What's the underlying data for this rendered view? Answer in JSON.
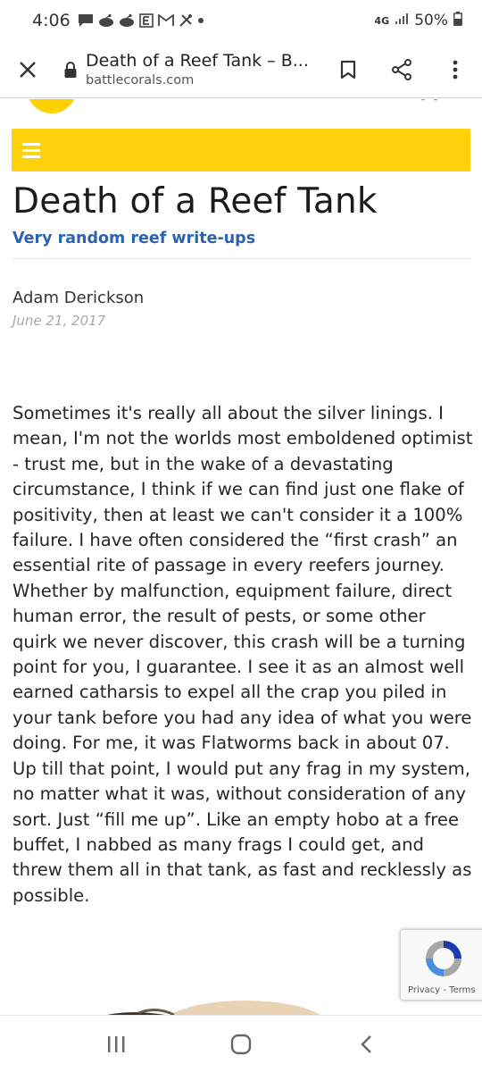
{
  "status_bar": {
    "time": "4:06",
    "network": "4G",
    "battery": "50%",
    "notification_icons": [
      "message-icon",
      "reddit-icon",
      "reddit-icon",
      "news-icon",
      "gmail-icon",
      "tools-icon",
      "dot-icon"
    ]
  },
  "toolbar": {
    "page_title": "Death of a Reef Tank – B...",
    "domain": "battlecorals.com"
  },
  "article": {
    "title": "Death of a Reef Tank",
    "category": "Very random reef write-ups",
    "author": "Adam Derickson",
    "date": "June 21, 2017",
    "body": "Sometimes it's really all about the silver linings.  I mean,  I'm not the worlds most emboldened optimist - trust me, but in the wake of a devastating circumstance, I think if we can find just one flake of positivity, then at least we can't consider it a 100% failure.   I have often considered the “first crash” an essential rite of passage in every reefers journey.  Whether by malfunction, equipment failure, direct human error, the result of pests, or some other quirk we never discover,  this crash will be a turning point for you,  I guarantee.  I see it as an almost well earned catharsis to expel all the crap you piled in your tank before you had any idea of what you were doing.  For me, it was Flatworms back in about 07.  Up till that point, I would put any frag in my system, no matter what it was, without consideration of any sort.  Just “fill me up”.  Like an empty hobo at a free buffet, I nabbed as many frags I could get, and threw them all in that tank, as fast and recklessly as possible."
  },
  "recaptcha": {
    "links": "Privacy - Terms"
  },
  "colors": {
    "menu_bar": "#fed10a",
    "category_link": "#2a64b0",
    "date": "#aaaaaa"
  }
}
